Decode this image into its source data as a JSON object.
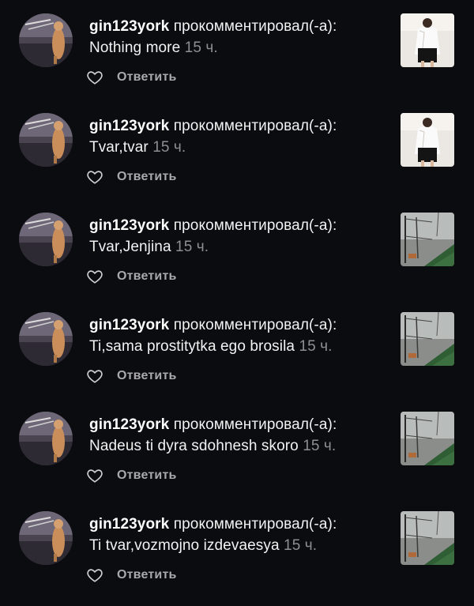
{
  "notifications": [
    {
      "username": "gin123york",
      "action": "прокомментировал(-а):",
      "comment": "Nothing more",
      "time": "15 ч.",
      "reply_label": "Ответить",
      "thumbnail": "photo-woman-white-shirt"
    },
    {
      "username": "gin123york",
      "action": "прокомментировал(-а):",
      "comment": "Tvar,tvar",
      "time": "15 ч.",
      "reply_label": "Ответить",
      "thumbnail": "photo-woman-white-shirt"
    },
    {
      "username": "gin123york",
      "action": "прокомментировал(-а):",
      "comment": "Tvar,Jenjina",
      "time": "15 ч.",
      "reply_label": "Ответить",
      "thumbnail": "photo-fence-grass"
    },
    {
      "username": "gin123york",
      "action": "прокомментировал(-а):",
      "comment": "Ti,sama prostitytka ego brosila",
      "time": "15 ч.",
      "reply_label": "Ответить",
      "thumbnail": "photo-fence-grass"
    },
    {
      "username": "gin123york",
      "action": "прокомментировал(-а):",
      "comment": "Nadeus ti dyra sdohnesh skoro",
      "time": "15 ч.",
      "reply_label": "Ответить",
      "thumbnail": "photo-fence-grass"
    },
    {
      "username": "gin123york",
      "action": "прокомментировал(-а):",
      "comment": "Ti tvar,vozmojno izdevaesya",
      "time": "15 ч.",
      "reply_label": "Ответить",
      "thumbnail": "photo-fence-grass"
    }
  ],
  "colors": {
    "background": "#0b0c10",
    "text": "#f2f2f2",
    "muted": "#8e8e93",
    "reply": "#a8a8ad"
  },
  "icons": {
    "like": "heart-outline-icon"
  }
}
